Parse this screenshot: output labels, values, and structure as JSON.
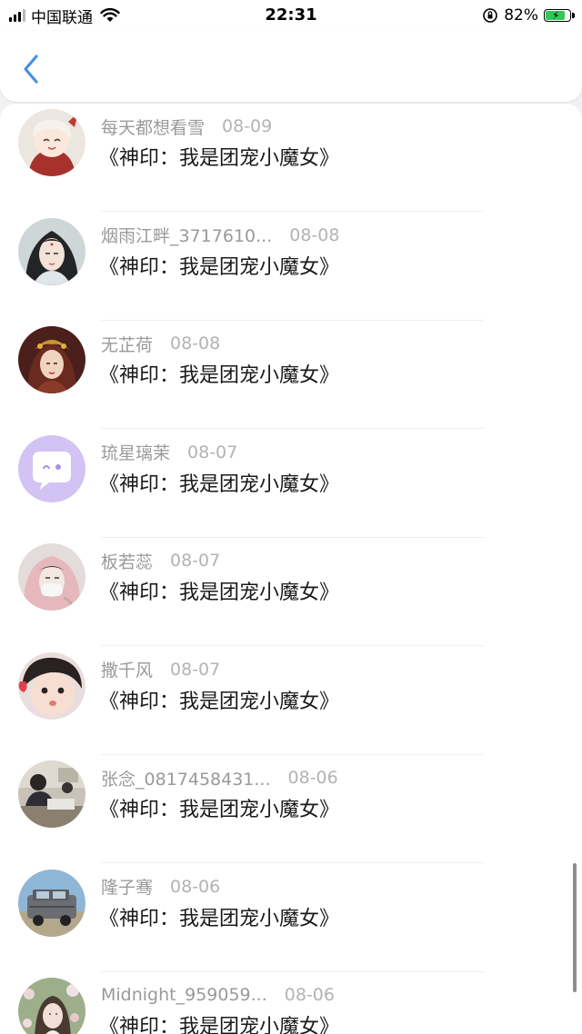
{
  "status_bar": {
    "carrier": "中国联通",
    "time": "22:31",
    "battery": "82%",
    "battery_level": 0.82
  },
  "nav": {
    "back_icon": "chevron-left-icon",
    "accent_color": "#4a90e2"
  },
  "rows": [
    {
      "name": "每天都想看雪",
      "date": "08-09",
      "title": "《神印：我是团宠小魔女》",
      "avatar": "anime-girl-avatar"
    },
    {
      "name": "烟雨江畔_3717610...",
      "date": "08-08",
      "title": "《神印：我是团宠小魔女》",
      "avatar": "ancient-girl-avatar"
    },
    {
      "name": "无芷荷",
      "date": "08-08",
      "title": "《神印：我是团宠小魔女》",
      "avatar": "ornate-girl-avatar"
    },
    {
      "name": "琉星璃茉",
      "date": "08-07",
      "title": "《神印：我是团宠小魔女》",
      "avatar": "default-chat-avatar"
    },
    {
      "name": "板若蕊",
      "date": "08-07",
      "title": "《神印：我是团宠小魔女》",
      "avatar": "hooded-girl-avatar"
    },
    {
      "name": "撒千风",
      "date": "08-07",
      "title": "《神印：我是团宠小魔女》",
      "avatar": "child-face-avatar"
    },
    {
      "name": "张念_0817458431...",
      "date": "08-06",
      "title": "《神印：我是团宠小魔女》",
      "avatar": "classroom-photo-avatar"
    },
    {
      "name": "隆子骞",
      "date": "08-06",
      "title": "《神印：我是团宠小魔女》",
      "avatar": "suv-car-avatar"
    },
    {
      "name": "Midnight_959059...",
      "date": "08-06",
      "title": "《神印：我是团宠小魔女》",
      "avatar": "flower-girl-avatar"
    }
  ]
}
